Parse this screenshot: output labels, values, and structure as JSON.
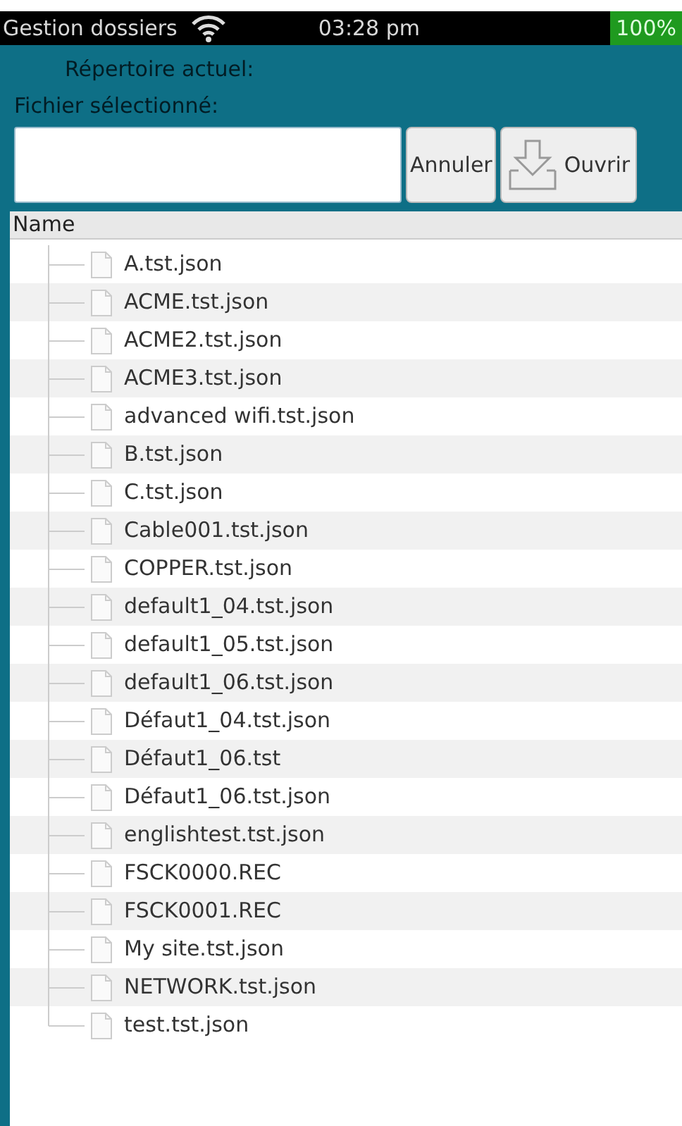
{
  "status_bar": {
    "title": "Gestion dossiers",
    "time": "03:28 pm",
    "battery": "100%"
  },
  "current_directory_label": "Répertoire actuel:",
  "selected_file_label": "Fichier sélectionné:",
  "buttons": [
    {
      "kind": "text",
      "label": "Annuler"
    },
    {
      "kind": "icon",
      "label": "Ouvrir"
    }
  ],
  "tree": {
    "columns": [
      "Name"
    ],
    "rows": [
      {
        "name": "A.tst.json"
      },
      {
        "name": "ACME.tst.json"
      },
      {
        "name": "ACME2.tst.json"
      },
      {
        "name": "ACME3.tst.json"
      },
      {
        "name": "advanced wifi.tst.json"
      },
      {
        "name": "B.tst.json"
      },
      {
        "name": "C.tst.json"
      },
      {
        "name": "Cable001.tst.json"
      },
      {
        "name": "COPPER.tst.json"
      },
      {
        "name": "default1_04.tst.json"
      },
      {
        "name": "default1_05.tst.json"
      },
      {
        "name": "default1_06.tst.json"
      },
      {
        "name": "Défaut1_04.tst.json"
      },
      {
        "name": "Défaut1_06.tst"
      },
      {
        "name": "Défaut1_06.tst.json"
      },
      {
        "name": "englishtest.tst.json"
      },
      {
        "name": "FSCK0000.REC"
      },
      {
        "name": "FSCK0001.REC"
      },
      {
        "name": "My site.tst.json"
      },
      {
        "name": "NETWORK.tst.json"
      },
      {
        "name": "test.tst.json"
      }
    ]
  }
}
